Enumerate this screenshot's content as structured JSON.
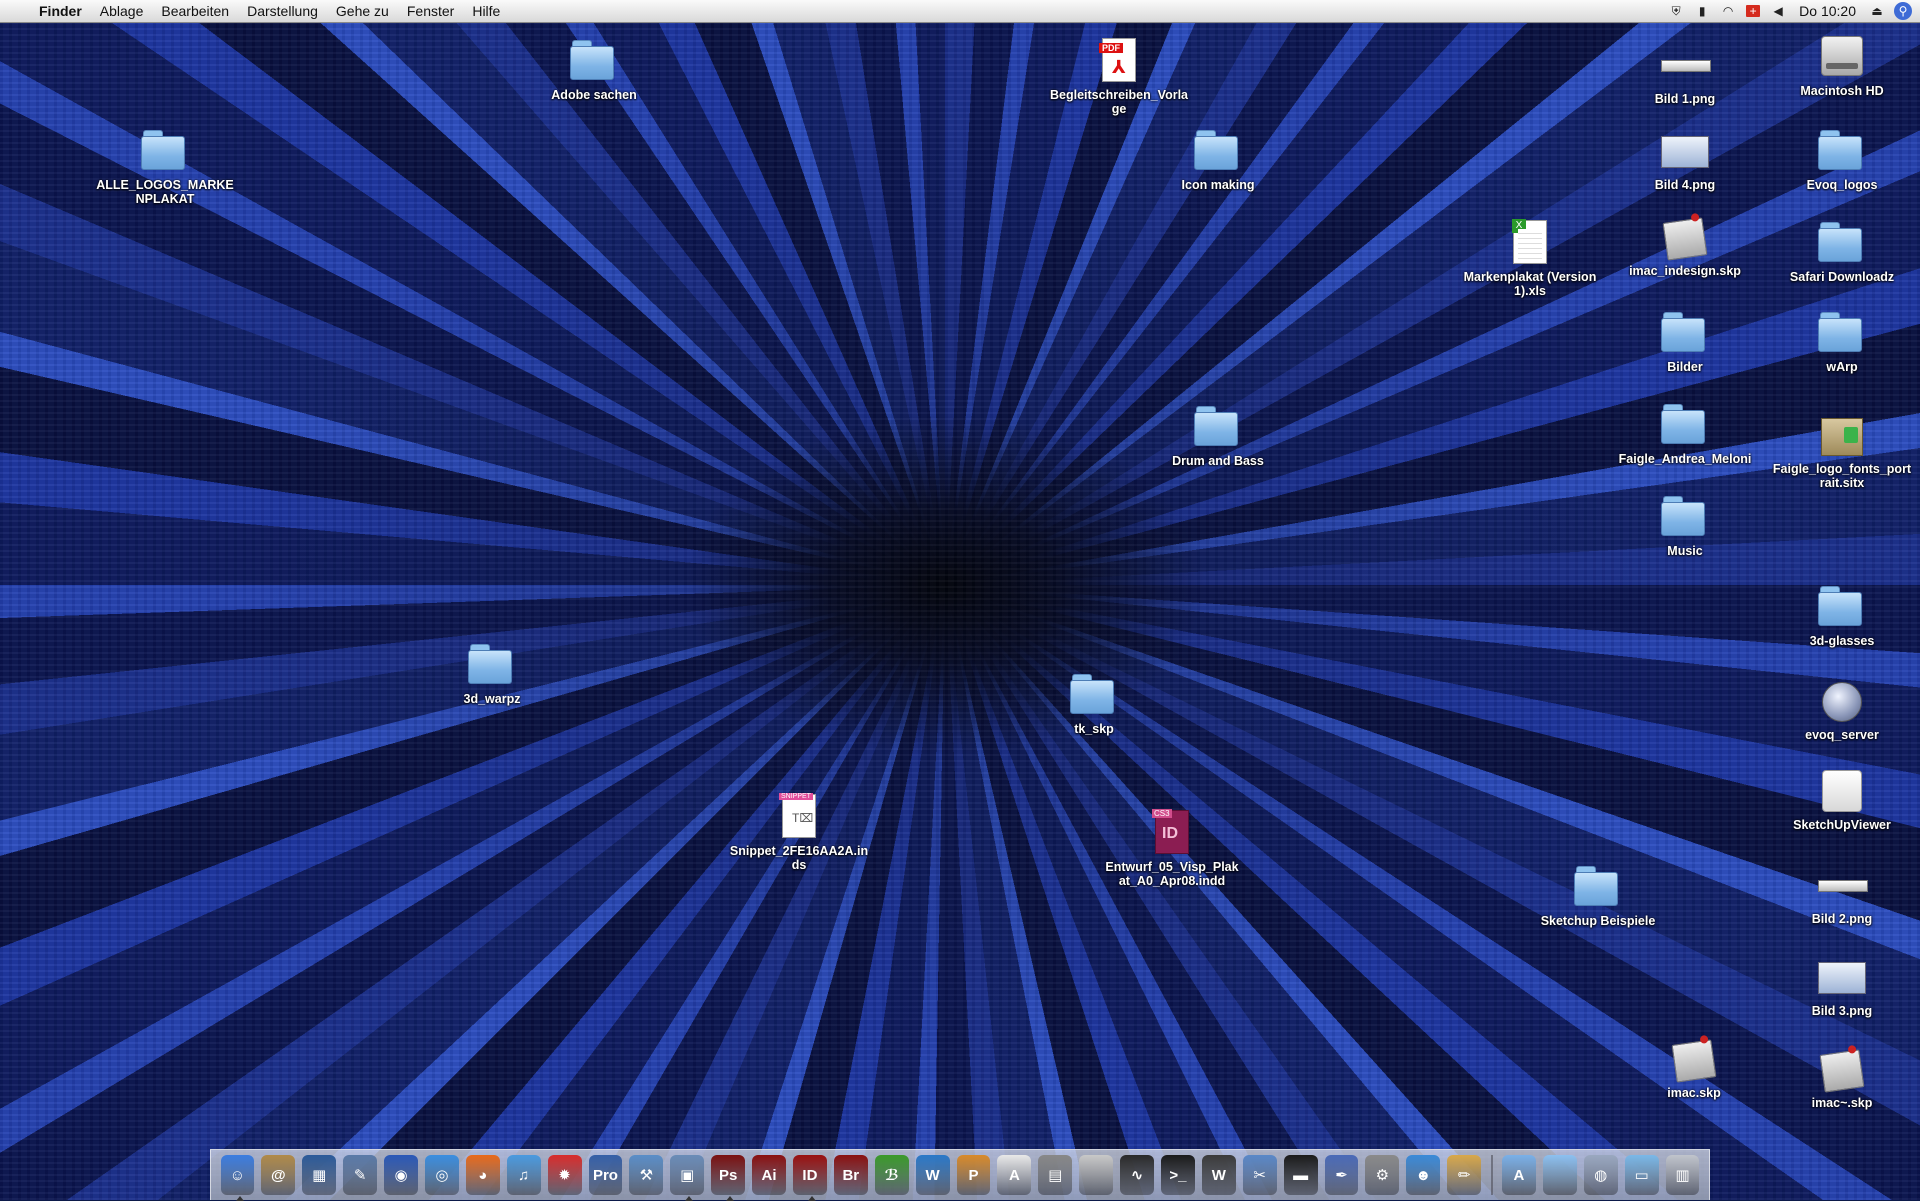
{
  "menubar": {
    "app_name": "Finder",
    "menus": [
      "Ablage",
      "Bearbeiten",
      "Darstellung",
      "Gehe zu",
      "Fenster",
      "Hilfe"
    ],
    "clock": "Do 10:20",
    "status_icons": [
      "shield-icon",
      "battery-icon",
      "wifi-icon",
      "swiss-flag-icon",
      "volume-icon",
      "eject-icon",
      "spotlight-icon"
    ]
  },
  "desktop": {
    "items": [
      {
        "label": "Adobe sachen",
        "type": "folder"
      },
      {
        "label": "Begleitschreiben_Vorlage",
        "type": "pdf"
      },
      {
        "label": "ALLE_LOGOS_MARKENPLAKAT",
        "type": "folder"
      },
      {
        "label": "Icon making",
        "type": "folder"
      },
      {
        "label": "Markenplakat (Version 1).xls",
        "type": "xls"
      },
      {
        "label": "Drum and  Bass",
        "type": "folder"
      },
      {
        "label": "3d_warpz",
        "type": "folder"
      },
      {
        "label": "tk_skp",
        "type": "folder"
      },
      {
        "label": "Snippet_2FE16AA2A.inds",
        "type": "snippet"
      },
      {
        "label": "Entwurf_05_Visp_Plakat_A0_Apr08.indd",
        "type": "indd"
      },
      {
        "label": "Sketchup Beispiele",
        "type": "folder"
      },
      {
        "label": "Bild 1.png",
        "type": "png-thin"
      },
      {
        "label": "Bild 4.png",
        "type": "png-shot"
      },
      {
        "label": "imac_indesign.skp",
        "type": "skp"
      },
      {
        "label": "Bilder",
        "type": "folder"
      },
      {
        "label": "Faigle_Andrea_Meloni",
        "type": "folder"
      },
      {
        "label": "Music",
        "type": "folder"
      },
      {
        "label": "imac.skp",
        "type": "skp"
      },
      {
        "label": "Macintosh HD",
        "type": "hd"
      },
      {
        "label": "Evoq_logos",
        "type": "folder"
      },
      {
        "label": "Safari Downloadz",
        "type": "folder"
      },
      {
        "label": "wArp",
        "type": "folder"
      },
      {
        "label": "Faigle_logo_fonts_portrait.sitx",
        "type": "sitx"
      },
      {
        "label": "3d-glasses",
        "type": "folder"
      },
      {
        "label": "evoq_server",
        "type": "server"
      },
      {
        "label": "SketchUpViewer",
        "type": "drive"
      },
      {
        "label": "Bild 2.png",
        "type": "png-thin"
      },
      {
        "label": "Bild 3.png",
        "type": "png-shot"
      },
      {
        "label": "imac~.skp",
        "type": "skp"
      }
    ]
  },
  "dock": {
    "apps": [
      {
        "name": "finder-icon",
        "glyph": "☺",
        "color": "#3b7de0",
        "running": true
      },
      {
        "name": "address-book-icon",
        "glyph": "@",
        "color": "#b08a48",
        "running": false
      },
      {
        "name": "iphoto-icon",
        "glyph": "▦",
        "color": "#2b5a9a",
        "running": false
      },
      {
        "name": "preview-icon",
        "glyph": "✎",
        "color": "#5a7aa8",
        "running": false
      },
      {
        "name": "google-earth-icon",
        "glyph": "◉",
        "color": "#2a58b8",
        "running": false
      },
      {
        "name": "safari-icon",
        "glyph": "◎",
        "color": "#3a8ee0",
        "running": false
      },
      {
        "name": "firefox-icon",
        "glyph": "◕",
        "color": "#e86a1c",
        "running": false
      },
      {
        "name": "itunes-icon",
        "glyph": "♫",
        "color": "#4a9adf",
        "running": false
      },
      {
        "name": "eye-candy-icon",
        "glyph": "✹",
        "color": "#d82c2c",
        "running": false
      },
      {
        "name": "pro-app-icon",
        "glyph": "Pro",
        "color": "#345fa8",
        "running": false
      },
      {
        "name": "xcode-icon",
        "glyph": "⚒",
        "color": "#5a8ec8",
        "running": false
      },
      {
        "name": "dashboard-icon",
        "glyph": "▣",
        "color": "#6a8cb8",
        "running": true
      },
      {
        "name": "photoshop-icon",
        "glyph": "Ps",
        "color": "#7a1010",
        "running": true
      },
      {
        "name": "illustrator-icon",
        "glyph": "Ai",
        "color": "#8a1010",
        "running": false
      },
      {
        "name": "indesign-icon",
        "glyph": "ID",
        "color": "#9a1010",
        "running": true
      },
      {
        "name": "bridge-icon",
        "glyph": "Br",
        "color": "#8a1010",
        "running": false
      },
      {
        "name": "green-app-icon",
        "glyph": "ℬ",
        "color": "#3a9a2a",
        "running": false
      },
      {
        "name": "web-app-icon",
        "glyph": "W",
        "color": "#2a78c8",
        "running": false
      },
      {
        "name": "paint-app-icon",
        "glyph": "P",
        "color": "#d88a2a",
        "running": false
      },
      {
        "name": "acrobat-icon",
        "glyph": "A",
        "color": "#e8e8e8",
        "running": false
      },
      {
        "name": "calculator-icon",
        "glyph": "▤",
        "color": "#888888",
        "running": false
      },
      {
        "name": "system-profiler-icon",
        "glyph": "",
        "color": "#c8c8c8",
        "running": false
      },
      {
        "name": "activity-monitor-icon",
        "glyph": "∿",
        "color": "#2a2a2a",
        "running": false
      },
      {
        "name": "terminal-icon",
        "glyph": ">_",
        "color": "#1a1a1a",
        "running": false
      },
      {
        "name": "textedit-icon",
        "glyph": "W",
        "color": "#3a3a3a",
        "running": false
      },
      {
        "name": "utility-icon",
        "glyph": "✂",
        "color": "#5a88c8",
        "running": false
      },
      {
        "name": "usb-stick-icon",
        "glyph": "▬",
        "color": "#1a1a1a",
        "running": false
      },
      {
        "name": "script-editor-icon",
        "glyph": "✒",
        "color": "#4a6ab8",
        "running": false
      },
      {
        "name": "grapher-icon",
        "glyph": "⚙",
        "color": "#8a8a8a",
        "running": false
      },
      {
        "name": "ichat-icon",
        "glyph": "☻",
        "color": "#3a8ad8",
        "running": false
      },
      {
        "name": "pencil-app-icon",
        "glyph": "✏",
        "color": "#d8a84a",
        "running": false
      }
    ],
    "right_items": [
      {
        "name": "applications-folder-icon",
        "glyph": "A",
        "color": "#7ab0e8"
      },
      {
        "name": "documents-folder-icon",
        "glyph": "",
        "color": "#8cc0f0"
      },
      {
        "name": "network-icon",
        "glyph": "◍",
        "color": "#9aa8c0"
      },
      {
        "name": "desktop-icon",
        "glyph": "▭",
        "color": "#7ab8e8"
      },
      {
        "name": "trash-icon",
        "glyph": "▥",
        "color": "#c0c4cc"
      }
    ]
  }
}
